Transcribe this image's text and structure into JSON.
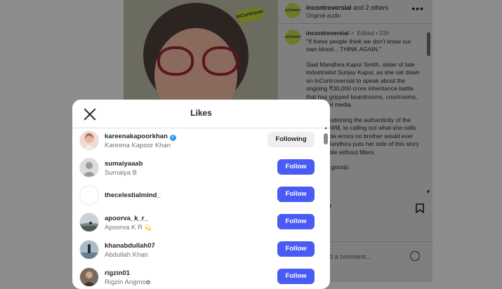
{
  "post": {
    "media_badge": "inControversial",
    "header": {
      "avatar_text": "inControversial",
      "account_primary": "incontroversial",
      "account_rest": " and 2 others",
      "audio": "Original audio",
      "more_icon": "more-horizontal-icon"
    },
    "caption": {
      "avatar_text": "inControversial",
      "username": "incontroversial",
      "edited": "Edited",
      "age": "23h",
      "paragraphs": [
        "\"If these people think we don't know our own blood... THINK AGAIN.\"",
        "Said Mandhira Kapur Smith, sister of late industrialist Sunjay Kapur, as she sat down on InControversial to speak about the ongoing ₹30,000 crore inheritance battle that has gripped boardrooms, courtrooms, and social media.",
        "From questioning the authenticity of the disputed Will, to calling out what she calls \"impossible errors no brother would ever make\", Mandhira puts her side of this story on the table without filters.",
        "This isn't gossip."
      ]
    },
    "comment_placeholder": "Add a comment..."
  },
  "likes_modal": {
    "title": "Likes",
    "close_icon": "close-icon",
    "users": [
      {
        "username": "kareenakapoorkhan",
        "full_name": "Kareena Kapoor Khan",
        "verified": true,
        "button": "Following",
        "avatar_color": "#f1d4cf"
      },
      {
        "username": "sumaiyaaab",
        "full_name": "Sumaiya B",
        "verified": false,
        "button": "Follow",
        "avatar_color": "#dcdcdc"
      },
      {
        "username": "thecelestialmind_",
        "full_name": "",
        "verified": false,
        "button": "Follow",
        "avatar_color": "#ffffff"
      },
      {
        "username": "apoorva_k_r_",
        "full_name": "Apoorva K R",
        "name_emoji": "💫",
        "verified": false,
        "button": "Follow",
        "avatar_color": "#5d6b73"
      },
      {
        "username": "khanabdullah07",
        "full_name": "Abdullah Khan",
        "verified": false,
        "button": "Follow",
        "avatar_color": "#8fa3b6"
      },
      {
        "username": "rigzin01",
        "full_name": "Rigzin Angmo",
        "name_emoji": "✿",
        "verified": false,
        "button": "Follow",
        "avatar_color": "#7a6a5e"
      }
    ]
  },
  "colors": {
    "follow_button": "#4a5bf5",
    "following_button": "#efefef",
    "verified_badge": "#3897f0",
    "overlay": "#8c8c8c"
  }
}
